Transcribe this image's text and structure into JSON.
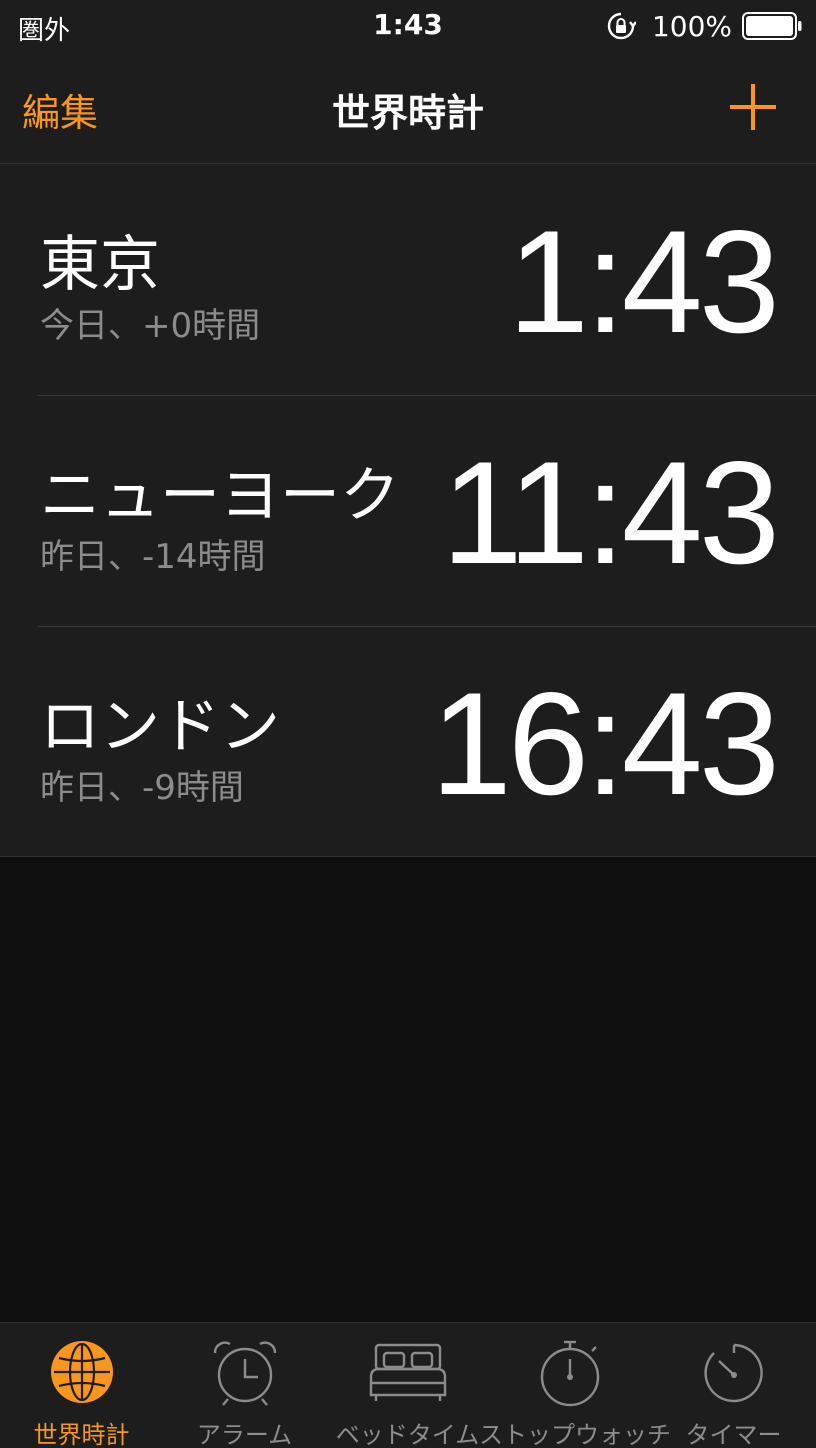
{
  "status": {
    "carrier": "圏外",
    "time": "1:43",
    "battery": "100%"
  },
  "nav": {
    "edit": "編集",
    "title": "世界時計",
    "add_icon": "plus-icon"
  },
  "clocks": [
    {
      "city": "東京",
      "offset": "今日、+0時間",
      "time": "1:43"
    },
    {
      "city": "ニューヨーク",
      "offset": "昨日、-14時間",
      "time": "11:43"
    },
    {
      "city": "ロンドン",
      "offset": "昨日、-9時間",
      "time": "16:43"
    }
  ],
  "tabs": [
    {
      "label": "世界時計",
      "icon": "globe-icon",
      "active": true
    },
    {
      "label": "アラーム",
      "icon": "alarm-clock-icon",
      "active": false
    },
    {
      "label": "ベッドタイム",
      "icon": "bed-icon",
      "active": false
    },
    {
      "label": "ストップウォッチ",
      "icon": "stopwatch-icon",
      "active": false
    },
    {
      "label": "タイマー",
      "icon": "timer-icon",
      "active": false
    }
  ],
  "colors": {
    "accent": "#f8961d",
    "background": "#0f0f0f",
    "list_background": "#1d1d1d",
    "secondary_text": "#8c8c8c"
  }
}
